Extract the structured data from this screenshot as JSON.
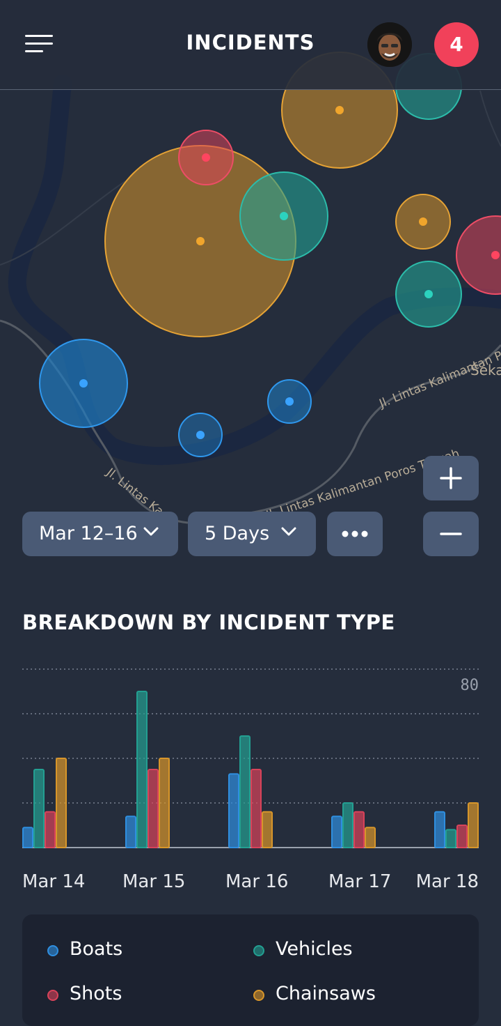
{
  "header": {
    "title": "INCIDENTS",
    "notification_count": "4"
  },
  "map": {
    "road_labels": [
      "Jl. Lintas Kalimantan Poros Tengah",
      "Jl. Lintas Kalimantan Poros Tengah",
      "Jl. Lintas Ka",
      "Seka"
    ],
    "incidents": [
      {
        "type": "chainsaws",
        "size": "large"
      },
      {
        "type": "chainsaws",
        "size": "medium"
      },
      {
        "type": "chainsaws",
        "size": "small"
      },
      {
        "type": "shots",
        "size": "small"
      },
      {
        "type": "shots",
        "size": "medium"
      },
      {
        "type": "vehicles",
        "size": "medium"
      },
      {
        "type": "vehicles",
        "size": "medium"
      },
      {
        "type": "vehicles",
        "size": "medium"
      },
      {
        "type": "boats",
        "size": "medium"
      },
      {
        "type": "boats",
        "size": "small"
      },
      {
        "type": "boats",
        "size": "small"
      }
    ]
  },
  "controls": {
    "date_range": "Mar 12–16",
    "duration": "5 Days",
    "more_icon": "more-dots-icon",
    "zoom_in_icon": "plus-icon",
    "zoom_out_icon": "minus-icon"
  },
  "breakdown": {
    "title": "BREAKDOWN BY INCIDENT TYPE"
  },
  "colors": {
    "boats": "#2f8fe0",
    "vehicles": "#23a092",
    "shots": "#d9435a",
    "chainsaws": "#d8962a",
    "background": "#252d3c"
  },
  "chart_data": {
    "type": "bar",
    "categories": [
      "Mar 14",
      "Mar 15",
      "Mar 16",
      "Mar 17",
      "Mar 18"
    ],
    "series": [
      {
        "name": "Boats",
        "values": [
          9,
          14,
          33,
          14,
          16
        ]
      },
      {
        "name": "Vehicles",
        "values": [
          35,
          70,
          50,
          20,
          8
        ]
      },
      {
        "name": "Shots",
        "values": [
          16,
          35,
          35,
          16,
          10
        ]
      },
      {
        "name": "Chainsaws",
        "values": [
          40,
          40,
          16,
          9,
          20
        ]
      }
    ],
    "ylim": [
      0,
      80
    ],
    "ytick_labels": [
      "80"
    ],
    "grid": true,
    "legend_position": "bottom"
  }
}
